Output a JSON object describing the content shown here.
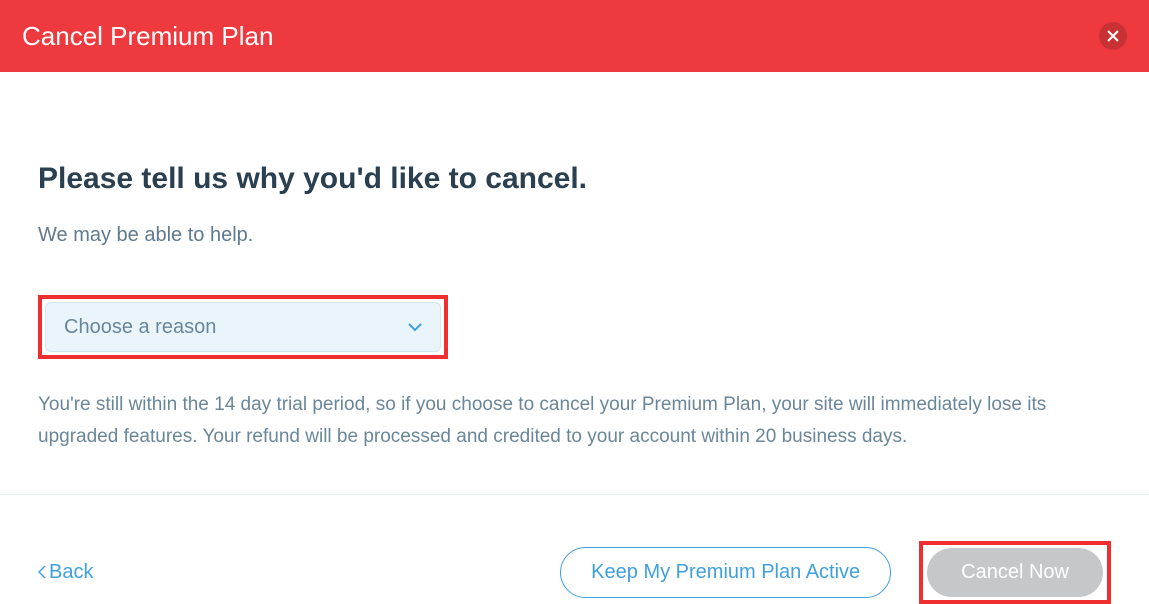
{
  "header": {
    "title": "Cancel Premium Plan"
  },
  "content": {
    "heading": "Please tell us why you'd like to cancel.",
    "subheading": "We may be able to help.",
    "select_placeholder": "Choose a reason",
    "info_text": "You're still within the 14 day trial period, so if you choose to cancel your Premium Plan, your site will immediately lose its upgraded features. Your refund will be processed and credited to your account within 20 business days."
  },
  "footer": {
    "back_label": "Back",
    "keep_active_label": "Keep My Premium Plan Active",
    "cancel_now_label": "Cancel Now"
  }
}
